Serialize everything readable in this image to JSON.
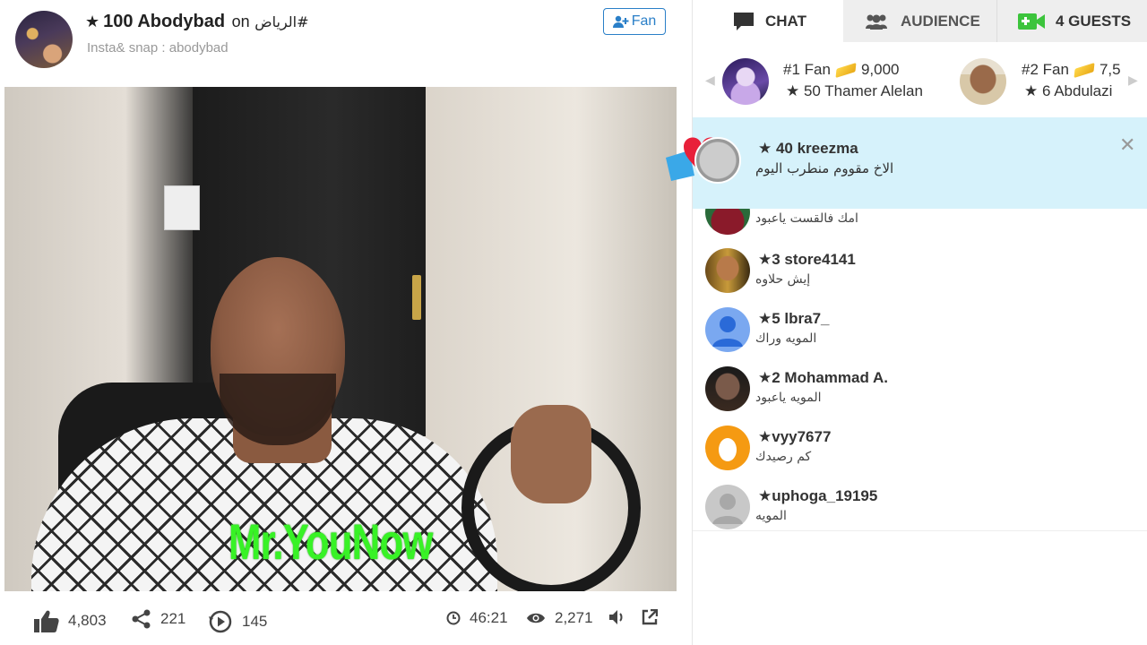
{
  "broadcast": {
    "host_star": "★",
    "host_name": "100 Abodybad",
    "on_text": "on",
    "hashtag": "الرياض#",
    "subtitle": "Insta& snap : abodybad",
    "fan_button_label": "Fan"
  },
  "video": {
    "watermark": "Mr.YouNow"
  },
  "stats": {
    "likes": "4,803",
    "shares": "221",
    "plays": "145",
    "duration": "46:21",
    "views": "2,271"
  },
  "tabs": {
    "chat": "CHAT",
    "audience": "AUDIENCE",
    "guests": "4 GUESTS"
  },
  "top_fans": [
    {
      "rank": "#1 Fan",
      "amount": "9,000",
      "user": "★  50 Thamer Alelan"
    },
    {
      "rank": "#2 Fan",
      "amount": "7,5",
      "user": "★  6 Abdulazi"
    }
  ],
  "highlight": {
    "name": "★  40 kreezma",
    "message": "الاخ مقووم منطرب اليوم"
  },
  "messages": [
    {
      "name": "",
      "text": "امك فالقست ياعبود"
    },
    {
      "name": "★3 store4141",
      "text": "إيش حلاوه"
    },
    {
      "name": "★5 lbra7_",
      "text": "المويه وراك"
    },
    {
      "name": "★2 Mohammad A.",
      "text": "المويه ياعبود"
    },
    {
      "name": "★vyy7677",
      "text": "كم رصيدك"
    },
    {
      "name": "★uphoga_19195",
      "text": "المويه"
    }
  ],
  "colors": {
    "accent": "#2a7fc8",
    "guests_icon": "#3cc43c",
    "highlight_bg": "#d6f2fb",
    "watermark": "#38f226"
  }
}
